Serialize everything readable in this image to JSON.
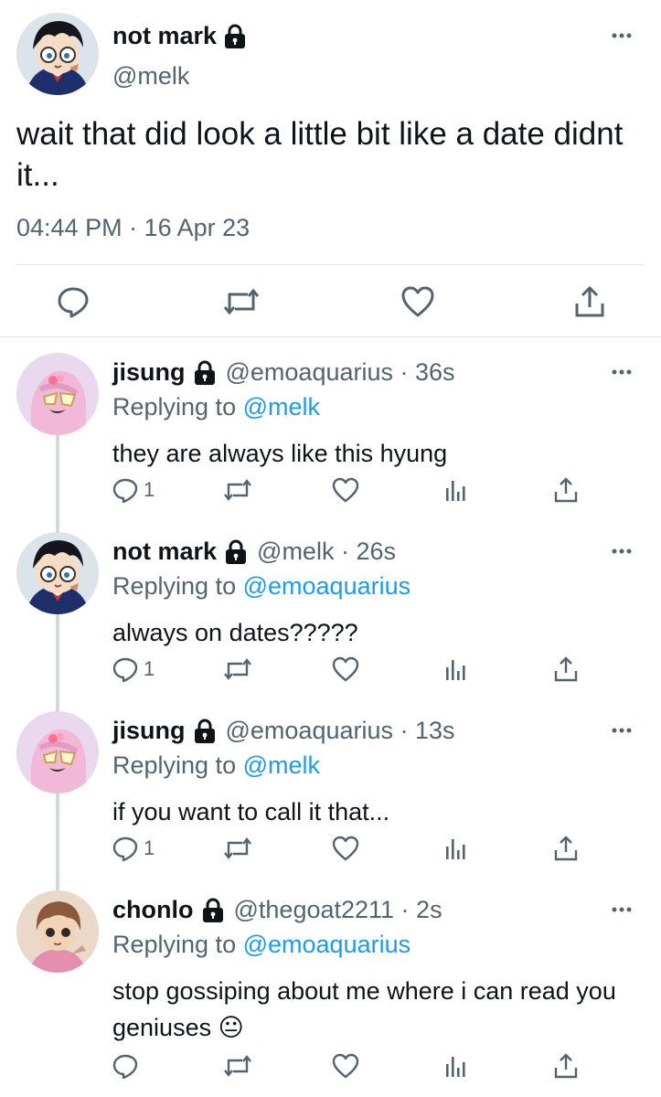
{
  "main_tweet": {
    "author_name": "not mark",
    "handle": "@melk",
    "text": "wait that did look a little bit like a date didnt it...",
    "timestamp": "04:44 PM · 16 Apr 23"
  },
  "replies": [
    {
      "name": "jisung",
      "handle_time": "@emoaquarius · 36s",
      "replying_prefix": "Replying to",
      "replying_to": "@melk",
      "text": "they are always like this hyung",
      "reply_count": "1"
    },
    {
      "name": "not mark",
      "handle_time": "@melk · 26s",
      "replying_prefix": "Replying to",
      "replying_to": "@emoaquarius",
      "text": "always on dates?????",
      "reply_count": "1"
    },
    {
      "name": "jisung",
      "handle_time": "@emoaquarius · 13s",
      "replying_prefix": "Replying to",
      "replying_to": "@melk",
      "text": "if you want to call it that...",
      "reply_count": "1"
    },
    {
      "name": "chonlo",
      "handle_time": "@thegoat2211 · 2s",
      "replying_prefix": "Replying to",
      "replying_to": "@emoaquarius",
      "text": "stop gossiping about me where i can read you geniuses",
      "emoji": "😐",
      "reply_count": ""
    }
  ],
  "icons": {
    "lock": "lock-icon",
    "more": "more-icon",
    "reply": "reply-icon",
    "retweet": "retweet-icon",
    "like": "like-icon",
    "views": "views-icon",
    "share": "share-icon"
  },
  "colors": {
    "text": "#0f1419",
    "secondary": "#536471",
    "mention": "#1d9bf0",
    "divider": "#e3e7ea",
    "thread_line": "#cfd9de"
  }
}
